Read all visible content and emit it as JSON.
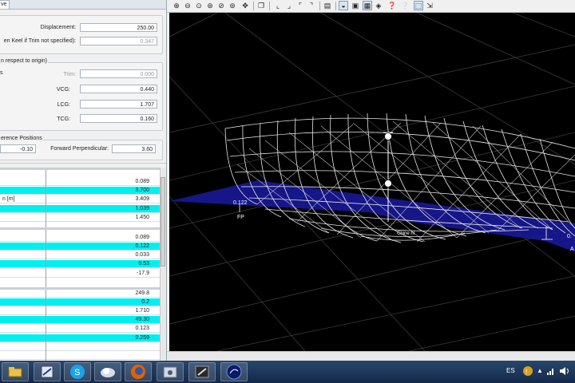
{
  "left_panel": {
    "tab_label": "ve",
    "displacement": {
      "label": "Displacement:",
      "value": "250.00"
    },
    "keel": {
      "label": "en Keel if Trim not specified):",
      "value": "0.347"
    },
    "cog_group": {
      "title": "n respect to origin)",
      "side_label": "s",
      "trim": {
        "label": "Trim:",
        "value": "0.000"
      },
      "vcg": {
        "label": "VCG:",
        "value": "0.440"
      },
      "lcg": {
        "label": "LCG:",
        "value": "1.707"
      },
      "tcg": {
        "label": "TCG:",
        "value": "0.160"
      }
    },
    "ref_group": {
      "title": "erence Positions",
      "aft_value": "-0.10",
      "fwd_label": "Forward Perpendicular:",
      "fwd_value": "3.60"
    },
    "table1": [
      {
        "label": "",
        "value": "0.089",
        "hi": false
      },
      {
        "label": "",
        "value": "3.700",
        "hi": true
      },
      {
        "label": "n [m]",
        "value": "3.409",
        "hi": false
      },
      {
        "label": "",
        "value": "1.039",
        "hi": true
      },
      {
        "label": "",
        "value": "1.450",
        "hi": false
      }
    ],
    "table2": [
      {
        "label": "",
        "value": "0.089",
        "hi": false
      },
      {
        "label": "",
        "value": "0.122",
        "hi": true
      },
      {
        "label": "",
        "value": "0.033",
        "hi": false
      },
      {
        "label": "",
        "value": "0.53",
        "hi": true
      },
      {
        "label": "",
        "value": "-17.9",
        "hi": false
      }
    ],
    "table3": [
      {
        "label": "",
        "value": "249.8",
        "hi": false
      },
      {
        "label": "",
        "value": "0.2",
        "hi": true
      },
      {
        "label": "",
        "value": "1.710",
        "hi": false
      },
      {
        "label": "",
        "value": "49.30",
        "hi": true
      },
      {
        "label": "",
        "value": "0.123",
        "hi": false
      },
      {
        "label": "",
        "value": "0.259",
        "hi": true
      }
    ]
  },
  "toolbar": {
    "icons": [
      "zoom-in-icon",
      "zoom-out-icon",
      "zoom-window-icon",
      "zoom-extents-icon",
      "zoom-previous-icon",
      "zoom-all-icon",
      "pan-icon",
      "copy-icon",
      "view-left-icon",
      "view-front-icon",
      "view-top-icon",
      "view-iso-icon",
      "page-icon",
      "shade-icon",
      "render-wire-icon",
      "render-shaded-icon",
      "render-solid-icon",
      "help-icon",
      "about-icon",
      "select-icon",
      "export-icon"
    ]
  },
  "viewport": {
    "fp_label": "FP",
    "draft_label": "0.122",
    "chine_label": "Chine hl",
    "side_value": "0.",
    "ap_label": "A"
  },
  "taskbar": {
    "apps": [
      "explorer-icon",
      "app-icon",
      "skype-icon",
      "browser-icon",
      "firefox-icon",
      "media-icon",
      "tools-icon",
      "lens-icon"
    ],
    "language": "ES"
  },
  "colors": {
    "highlight": "#00f0f0",
    "waterplane": "#1a1aa0",
    "hull": "#ffffff",
    "taskbar": "#1d3557"
  }
}
